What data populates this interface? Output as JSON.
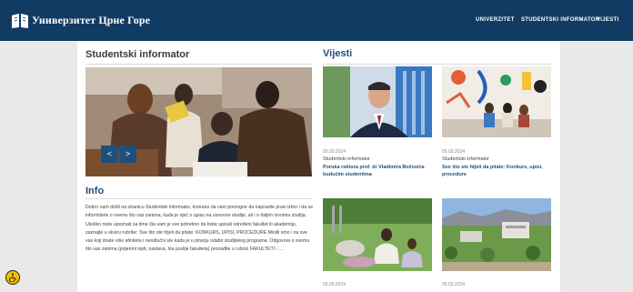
{
  "header": {
    "brand": "Универзитет Црне Горе",
    "nav": [
      "UNIVERZITET",
      "STUDENTSKI INFORMATOR",
      "VIJESTI"
    ],
    "bg_color": "#123b63"
  },
  "main": {
    "title": "Studentski informator",
    "slider": {
      "prev_label": "<",
      "next_label": ">"
    },
    "info_title": "Info",
    "info_text": "Dobro nam došli na stranicu Studentski informator, kreirano da vam pomogne da napravite pravi izbor i da se informišete o svemu što vas zanima, kada je riječ o upisu na osnovne studije, ali i o daljim nivoima studija. Ukoliko niste upoznati sa time šta vam je sve potrebno da biste upisali određeni fakultet ili akademiju, zaznajte u okviru rubrike: Sve što ste htjeli da pitate: KONKURS, UPISI, PROCEDURE Mislili smo i na sve vas koji imate više afiniteta i neodlučni ste kada je u pitanju odabir studijskog programa. Odgovore o svemu što vas zanima (prijemni ispit, nastava, šta poslije fakulteta) pronađite u rubrici FAKULTETI - ..."
  },
  "news": {
    "title": "Vijesti",
    "items": [
      {
        "date": "05.03.2024",
        "category": "Studentski informator",
        "title": "Poruka rektora prof. dr Vladimira Božovića budućim studentima",
        "image": "rector-portrait"
      },
      {
        "date": "05.03.2024",
        "category": "Studentski informator",
        "title": "Sve što ste htjeli da pitate: Konkurs, upisi, procedure",
        "image": "students-mural"
      },
      {
        "date": "05.03.2024",
        "category": "",
        "title": "",
        "image": "students-picnic"
      },
      {
        "date": "05.03.2024",
        "category": "",
        "title": "",
        "image": "campus-aerial"
      }
    ]
  },
  "accessibility": {
    "icon": "wheelchair-icon"
  }
}
